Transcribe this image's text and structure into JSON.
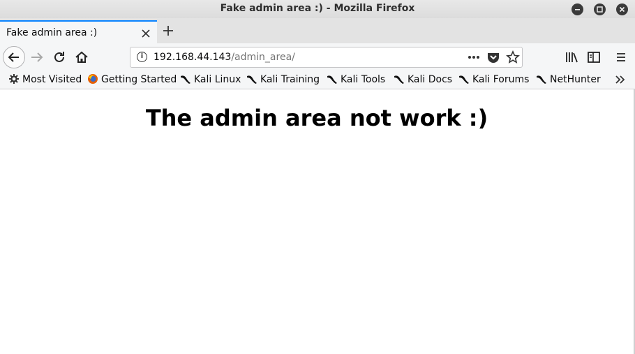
{
  "window": {
    "title": "Fake admin area :) - Mozilla Firefox"
  },
  "tab": {
    "label": "Fake admin area :)"
  },
  "url": {
    "host": "192.168.44.143",
    "path": "/admin_area/"
  },
  "bookmarks": [
    {
      "label": "Most Visited",
      "icon": "gear-icon"
    },
    {
      "label": "Getting Started",
      "icon": "firefox-icon"
    },
    {
      "label": "Kali Linux",
      "icon": "kali-dragon-icon"
    },
    {
      "label": "Kali Training",
      "icon": "kali-dragon-icon"
    },
    {
      "label": "Kali Tools",
      "icon": "kali-dragon-icon"
    },
    {
      "label": "Kali Docs",
      "icon": "kali-dragon-icon"
    },
    {
      "label": "Kali Forums",
      "icon": "kali-dragon-icon"
    },
    {
      "label": "NetHunter",
      "icon": "kali-dragon-icon"
    }
  ],
  "page": {
    "heading": "The admin area not work :)"
  },
  "colors": {
    "tab_accent": "#0a84ff",
    "chrome_bg": "#f5f6f7",
    "tabbar_bg": "#e3e3e3"
  }
}
